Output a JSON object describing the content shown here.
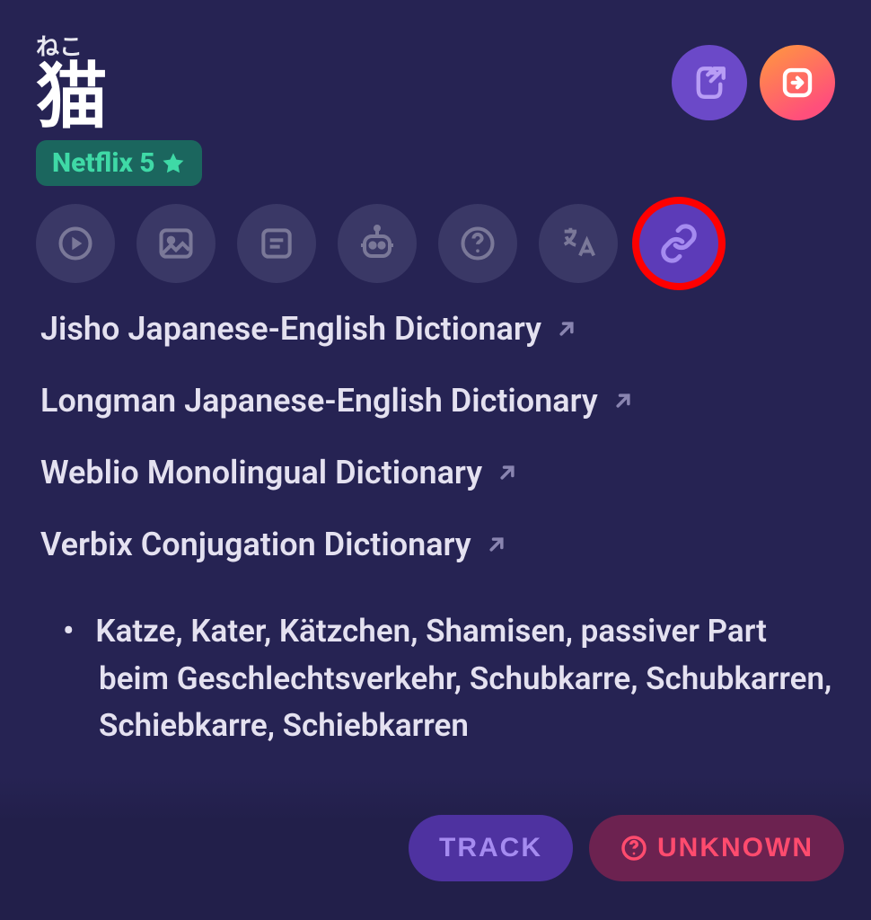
{
  "word": {
    "furigana": "ねこ",
    "kanji": "猫"
  },
  "tag": {
    "label": "Netflix 5"
  },
  "toolbar": {
    "items": [
      {
        "name": "play-icon"
      },
      {
        "name": "image-icon"
      },
      {
        "name": "notes-icon"
      },
      {
        "name": "robot-icon"
      },
      {
        "name": "help-icon"
      },
      {
        "name": "translate-icon"
      },
      {
        "name": "link-icon",
        "active": true,
        "highlighted": true
      }
    ]
  },
  "links": [
    {
      "label": "Jisho Japanese-English Dictionary"
    },
    {
      "label": "Longman Japanese-English Dictionary"
    },
    {
      "label": "Weblio Monolingual Dictionary"
    },
    {
      "label": "Verbix Conjugation Dictionary"
    }
  ],
  "definitions": [
    "Katze, Kater, Kätzchen, Shamisen, passiver Part beim Geschlechtsverkehr, Schubkarre, Schubkarren, Schiebkarre, Schiebkarren"
  ],
  "footer": {
    "track_label": "TRACK",
    "unknown_label": "UNKNOWN"
  }
}
